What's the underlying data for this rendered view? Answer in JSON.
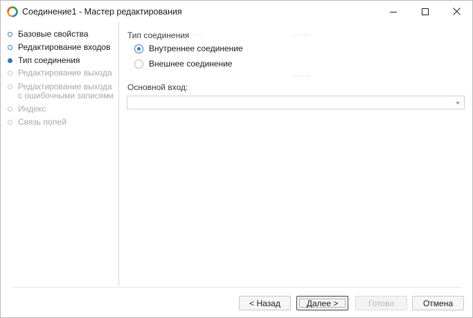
{
  "window": {
    "title": "Соединение1 - Мастер редактирования",
    "controls": {
      "minimize": "minimize-icon",
      "maximize": "maximize-icon",
      "close": "close-icon"
    }
  },
  "steps": [
    {
      "label": "Базовые свойства",
      "state": "done"
    },
    {
      "label": "Редактирование входов",
      "state": "done"
    },
    {
      "label": "Тип соединения",
      "state": "active"
    },
    {
      "label": "Редактирование выхода",
      "state": "todo"
    },
    {
      "label": "Редактирование выхода с ошибочными записями",
      "state": "todo"
    },
    {
      "label": "Индекс",
      "state": "todo"
    },
    {
      "label": "Связь полей",
      "state": "todo"
    }
  ],
  "join_type": {
    "caption": "Тип соединения",
    "options": [
      {
        "label": "Внутреннее соединение",
        "checked": true
      },
      {
        "label": "Внешнее соединение",
        "checked": false
      }
    ]
  },
  "main_input": {
    "label": "Основной вход:",
    "value": ""
  },
  "buttons": {
    "back": "< Назад",
    "next": "Далее >",
    "finish": "Готово",
    "cancel": "Отмена"
  },
  "colors": {
    "accent": "#2e79c4",
    "disabled_text": "#a8a8a8"
  }
}
